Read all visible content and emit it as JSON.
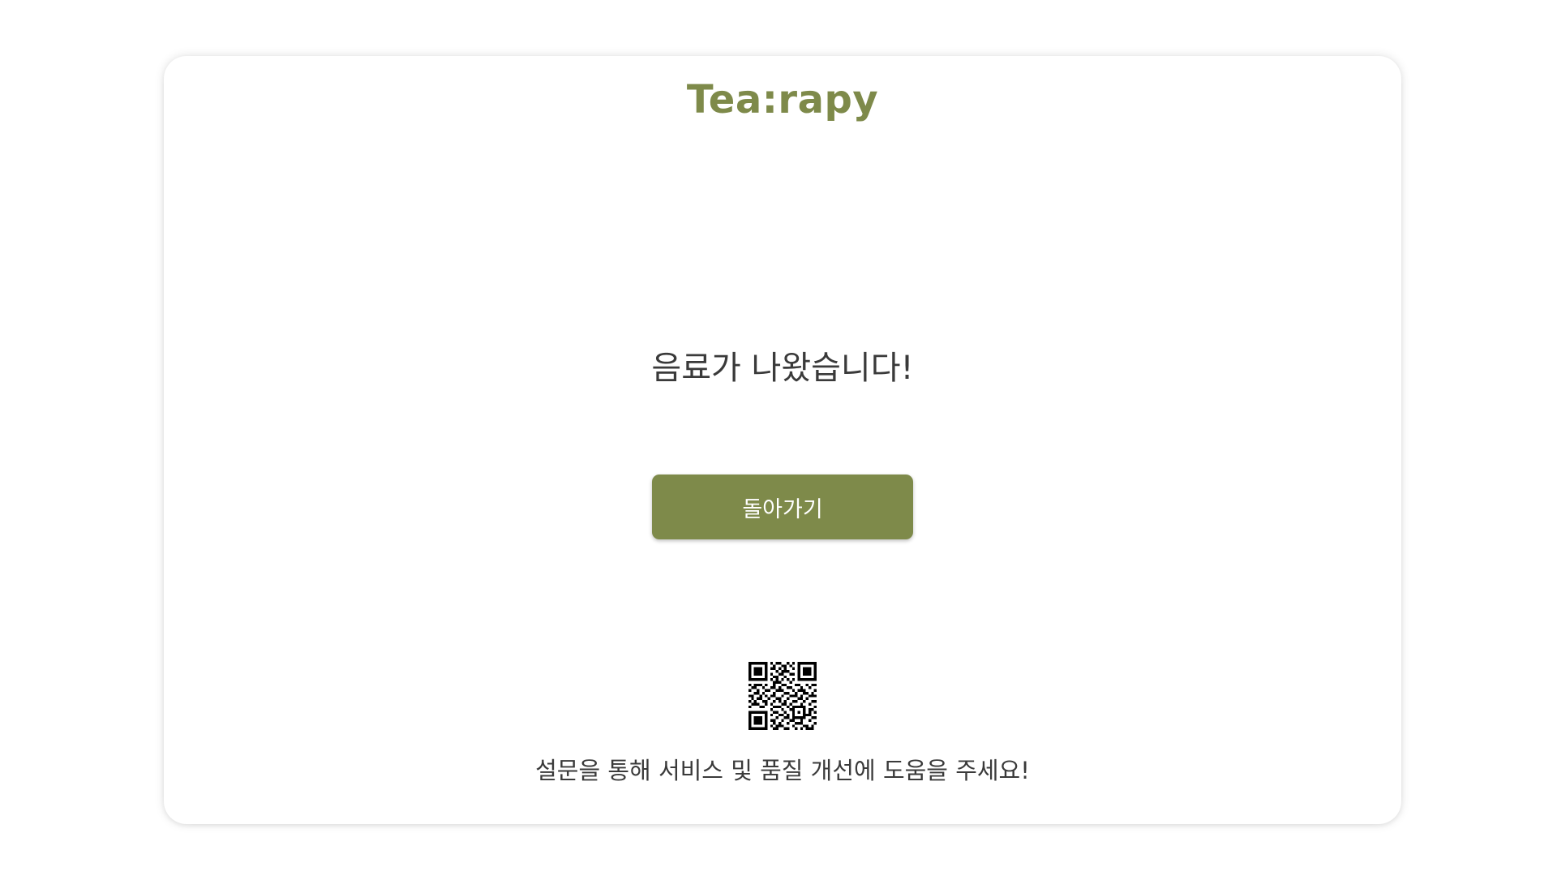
{
  "brand": {
    "name": "Tea:rapy",
    "color": "#7e8a4a"
  },
  "main": {
    "message": "음료가 나왔습니다!",
    "back_label": "돌아가기",
    "button_color": "#7e8a4a"
  },
  "survey": {
    "qr_icon": "qr-code-icon",
    "text": "설문을 통해 서비스 및 품질 개선에 도움을 주세요!"
  }
}
